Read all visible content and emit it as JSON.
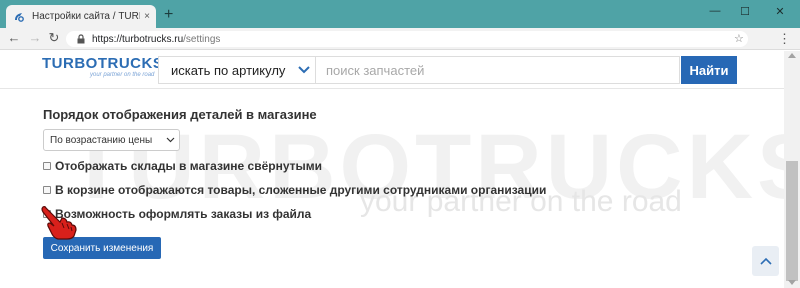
{
  "browser": {
    "tab_title": "Настройки сайта / TURBOTRUCKS",
    "tab_close": "×",
    "new_tab": "+",
    "url_host": "https://turbotrucks.ru",
    "url_path": "/settings",
    "window_min": "—",
    "window_max": "☐",
    "window_close": "✕"
  },
  "header": {
    "logo_part1": "TURBO",
    "logo_part2": "TRUCKS",
    "logo_tagline": "your partner on the road",
    "search_mode": "искать по артикулу",
    "search_placeholder": "поиск запчастей",
    "find_button": "Найти"
  },
  "watermark": {
    "big": "TURBOTRUCKS",
    "small": "your partner on the road"
  },
  "settings": {
    "section_title": "Порядок отображения деталей в магазине",
    "sort_value": "По возрастанию цены",
    "options": [
      {
        "label": "Отображать склады в магазине свёрнутыми",
        "checked": false
      },
      {
        "label": "В корзине отображаются товары, сложенные другими сотрудниками организации",
        "checked": false
      },
      {
        "label": "Возможность оформлять заказы из файла",
        "checked": false
      }
    ],
    "save_button": "Сохранить изменения"
  },
  "colors": {
    "brand_blue": "#2768b5",
    "titlebar": "#4fa3a6"
  }
}
